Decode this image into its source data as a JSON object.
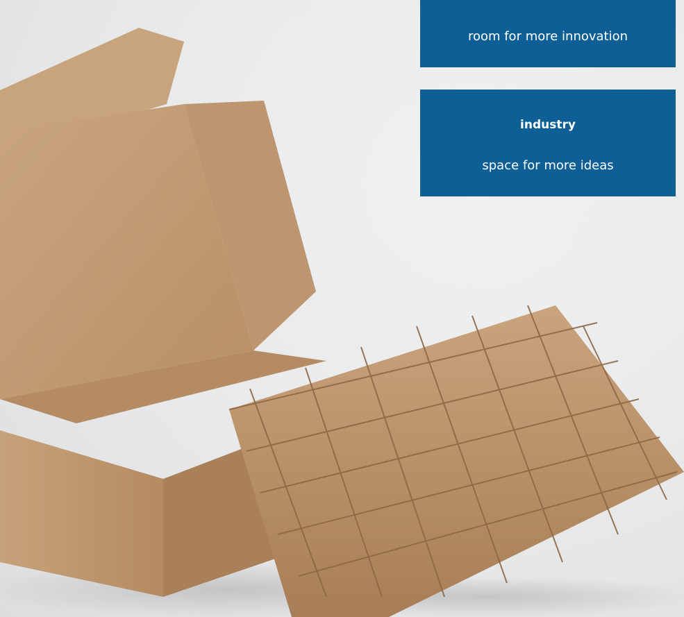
{
  "hero": {
    "image_label": "cardboard-box-with-divider-insert-photo"
  },
  "cards": [
    {
      "title": "",
      "text": "room for more innovation"
    },
    {
      "title": "industry",
      "text": "space for more ideas"
    }
  ],
  "colors": {
    "card_background": "#0d5f96",
    "card_text": "#ffffff",
    "cardboard": "#c7a27a",
    "background": "#e9eaeb"
  }
}
